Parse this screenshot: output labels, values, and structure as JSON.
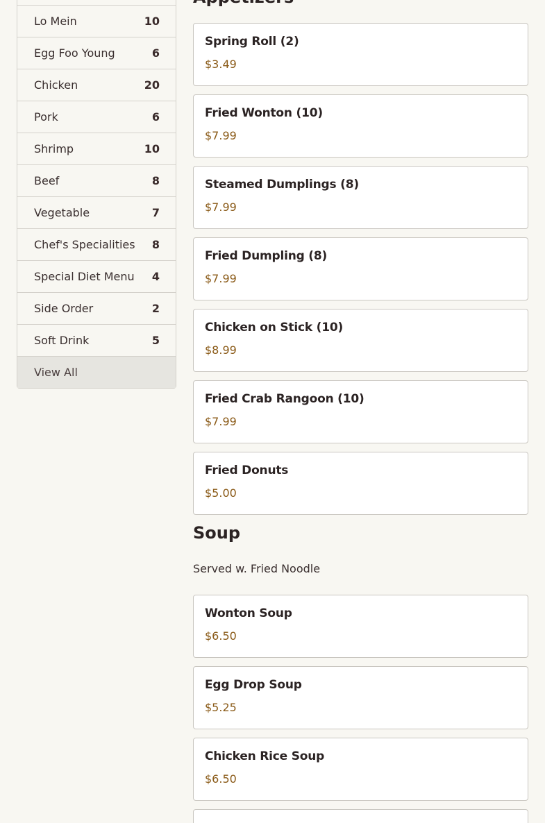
{
  "sidebar": {
    "items": [
      {
        "label": "Lo Mein",
        "count": "10"
      },
      {
        "label": "Egg Foo Young",
        "count": "6"
      },
      {
        "label": "Chicken",
        "count": "20"
      },
      {
        "label": "Pork",
        "count": "6"
      },
      {
        "label": "Shrimp",
        "count": "10"
      },
      {
        "label": "Beef",
        "count": "8"
      },
      {
        "label": "Vegetable",
        "count": "7"
      },
      {
        "label": "Chef's Specialities",
        "count": "8"
      },
      {
        "label": "Special Diet Menu",
        "count": "4"
      },
      {
        "label": "Side Order",
        "count": "2"
      },
      {
        "label": "Soft Drink",
        "count": "5"
      }
    ],
    "view_all_label": "View All"
  },
  "appetizers": {
    "title": "Appetizers",
    "items": [
      {
        "name": "Spring Roll (2)",
        "price": "$3.49"
      },
      {
        "name": "Fried Wonton (10)",
        "price": "$7.99"
      },
      {
        "name": "Steamed Dumplings (8)",
        "price": "$7.99"
      },
      {
        "name": "Fried Dumpling (8)",
        "price": "$7.99"
      },
      {
        "name": "Chicken on Stick (10)",
        "price": "$8.99"
      },
      {
        "name": "Fried Crab Rangoon (10)",
        "price": "$7.99"
      },
      {
        "name": "Fried Donuts",
        "price": "$5.00"
      }
    ]
  },
  "soup": {
    "title": "Soup",
    "description": "Served w. Fried Noodle",
    "items": [
      {
        "name": "Wonton Soup",
        "price": "$6.50"
      },
      {
        "name": "Egg Drop Soup",
        "price": "$5.25"
      },
      {
        "name": "Chicken Rice Soup",
        "price": "$6.50"
      }
    ]
  }
}
